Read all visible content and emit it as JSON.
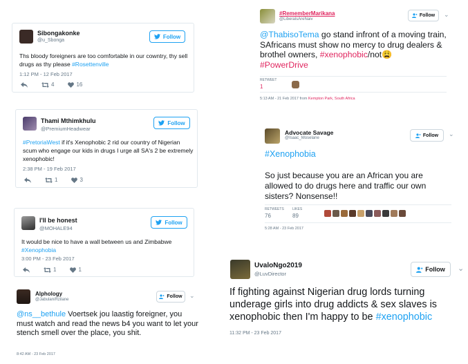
{
  "t1": {
    "name": "Sibongakonke",
    "handle": "@u_Sbonga",
    "follow": "Follow",
    "text_before": "Ths bloody foreigners are too comfortable in our cowntry, thy sell drugs as thy please ",
    "hashtag": "#Rosettenville",
    "time": "1:12 PM - 12 Feb 2017",
    "retweets": "4",
    "likes": "16"
  },
  "t2": {
    "name": "Thami Mthimkhulu",
    "handle": "@PremiumHeadwear",
    "follow": "Follow",
    "hashtag": "#PretoriaWest",
    "text_after": " if it's Xenophobic 2 rid our country of Nigerian scum who engage our kids in drugs I urge all SA's 2 be extremely xenophobic!",
    "time": "2:38 PM - 19 Feb 2017",
    "retweets": "1",
    "likes": "3"
  },
  "t3": {
    "name": "I'll be honest",
    "handle": "@MOHALE94",
    "follow": "Follow",
    "text": "It would be nice to have a wall between us and Zimbabwe",
    "hashtag": "#Xenophobia",
    "time": "3:00 PM - 23 Feb 2017",
    "retweets": "1",
    "likes": "1"
  },
  "t4": {
    "name": "Alphology",
    "handle": "@JabulaniRzilane",
    "follow": "Follow",
    "mention": "@ns__bethule",
    "text_after": " Voertsek jou laastig foreigner, you must watch and read the news b4 you want to let your stench smell over the place, you shit.",
    "time": "8:42 AM - 23 Feb 2017"
  },
  "t5": {
    "name": "#RememberMarikana",
    "handle": "@LiberalsAreNaiv",
    "follow": "Follow",
    "mention": "@ThabisoTema",
    "text_mid": " go stand infront of a moving train, SAfricans must show no mercy to drug dealers & brothel owners, ",
    "hashtag1": "#xenophobic",
    "text_not": "/not",
    "emoji": "😩",
    "hashtag2": "#PowerDrive",
    "retweet_label": "RETWEET",
    "retweet_count": "1",
    "time": "5:13 AM - 21 Feb 2017 from ",
    "location": "Kempton Park, South Africa"
  },
  "t6": {
    "name": "Advocate Savage",
    "handle": "@Isaac_Moselane",
    "follow": "Follow",
    "hashtag": "#Xenophobia",
    "text": "So just because you are an African you are allowed to do drugs here and traffic our own sisters?  Nonsense!!",
    "retweets_label": "RETWEETS",
    "retweets": "76",
    "likes_label": "LIKES",
    "likes": "89",
    "time": "5:28 AM - 23 Feb 2017"
  },
  "t7": {
    "name": "UvaloNgo2019",
    "handle": "@LuvDirector",
    "follow": "Follow",
    "text": "If fighting against Nigerian drug lords turning underage girls into drug addicts & sex slaves is xenophobic then I'm happy to be ",
    "hashtag": "#xenophobic",
    "time": "11:32 PM - 23 Feb 2017"
  },
  "colors": {
    "link": "#1da1f2",
    "like": "#e0245e",
    "muted": "#657786"
  },
  "icons": [
    "twitter-bird-icon",
    "add-user-icon",
    "reply-icon",
    "retweet-icon",
    "heart-icon",
    "chevron-down-icon"
  ]
}
